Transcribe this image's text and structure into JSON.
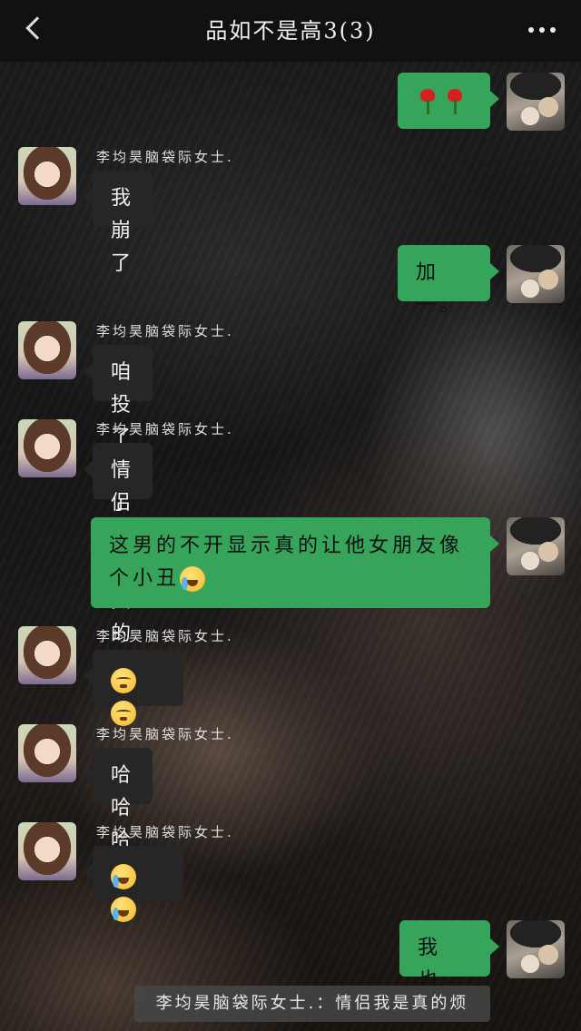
{
  "header": {
    "title": "品如不是高3(3)"
  },
  "sender_name": "李均昊脑袋际女士.",
  "messages": [
    {
      "from": "self",
      "text": "",
      "emoji": [
        "tulip",
        "tulip"
      ]
    },
    {
      "from": "friend",
      "text": "我崩了"
    },
    {
      "from": "self",
      "text": "加一。"
    },
    {
      "from": "friend",
      "text": "咱投了算了"
    },
    {
      "from": "friend",
      "text": "情侣我是真的烦"
    },
    {
      "from": "self",
      "text": "这男的不开显示真的让他女朋友像个小丑",
      "emoji": [
        "laugh-cry"
      ]
    },
    {
      "from": "friend",
      "text": "",
      "emoji": [
        "unamused",
        "unamused"
      ]
    },
    {
      "from": "friend",
      "text": "哈哈哈"
    },
    {
      "from": "friend",
      "text": "",
      "emoji": [
        "laugh-cry",
        "laugh-cry"
      ]
    },
    {
      "from": "self",
      "text": "我也。"
    }
  ],
  "preview": {
    "text": "李均昊脑袋际女士.：情侣我是真的烦"
  },
  "colors": {
    "self_bubble": "#36a45b",
    "friend_bubble": "#262626",
    "header_bg": "#111111"
  }
}
